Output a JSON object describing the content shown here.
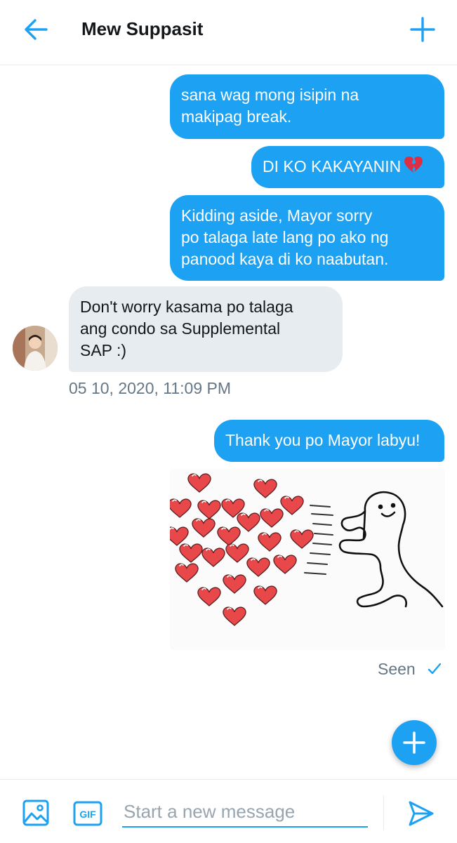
{
  "header": {
    "back_icon": "arrow-left-icon",
    "title": "Mew Suppasit",
    "add_icon": "plus-icon"
  },
  "colors": {
    "accent": "#1da1f2",
    "incoming_bubble": "#e6ecf0",
    "muted_text": "#657786",
    "heart": "#e8484a"
  },
  "messages": {
    "m1": "sana wag mong isipin na\nmakipag break.",
    "m2": "DI KO KAKAYANIN",
    "m2_emoji": "broken-heart-icon",
    "m3": "Kidding aside, Mayor sorry\npo talaga late lang po ako ng\npanood kaya di ko naabutan.",
    "m4": "Don't worry kasama po talaga\nang condo sa Supplemental\nSAP :)",
    "m4_timestamp": "05 10, 2020, 11:09 PM",
    "m5": "Thank you po Mayor labyu!",
    "m6_sticker": "hearts-push-sticker"
  },
  "status": {
    "seen": "Seen",
    "seen_icon": "checkmark-icon"
  },
  "fab": {
    "icon": "plus-icon"
  },
  "composer": {
    "media_icon": "image-icon",
    "gif_icon": "gif-icon",
    "gif_label": "GIF",
    "placeholder": "Start a new message",
    "value": "",
    "send_icon": "send-icon"
  }
}
